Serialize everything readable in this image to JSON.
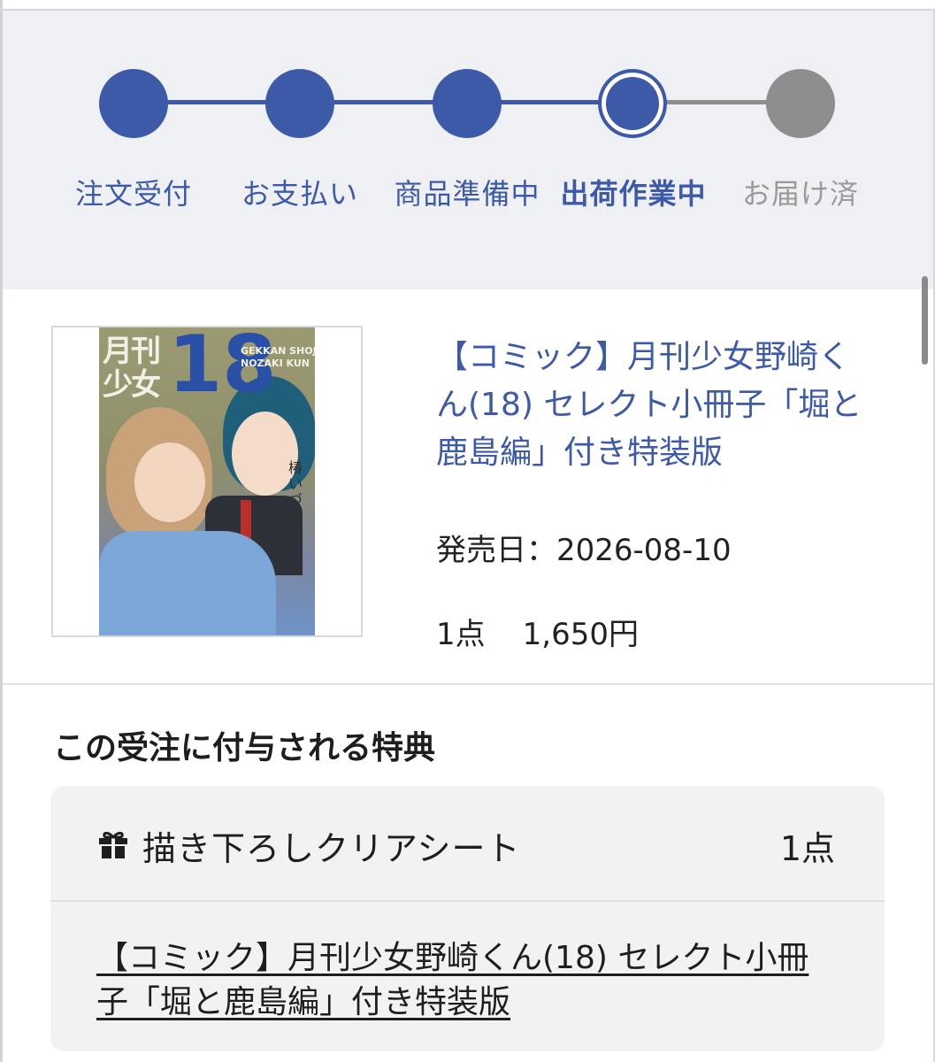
{
  "progress": {
    "steps": [
      {
        "label": "注文受付",
        "state": "done"
      },
      {
        "label": "お支払い",
        "state": "done"
      },
      {
        "label": "商品準備中",
        "state": "done"
      },
      {
        "label": "出荷作業中",
        "state": "current"
      },
      {
        "label": "お届け済",
        "state": "todo"
      }
    ],
    "colors": {
      "accent": "#3d5aa8",
      "inactive": "#8e8e8e"
    }
  },
  "product": {
    "title": "【コミック】月刊少女野崎くん(18) セレクト小冊子「堀と鹿島編」付き特装版",
    "release_date": "発売日：2026-08-10",
    "quantity": "1点",
    "price": "1,650円",
    "cover": {
      "number": "18",
      "title_jp": "月刊少女",
      "title_en": "GEKKAN SHOJO\nNOZAKI KUN",
      "author": "椿いづみ"
    }
  },
  "bonus": {
    "heading": "この受注に付与される特典",
    "item_icon": "gift-icon",
    "item_name": "描き下ろしクリアシート",
    "item_count": "1点",
    "linked_product": "【コミック】月刊少女野崎くん(18) セレクト小冊子「堀と鹿島編」付き特装版"
  }
}
